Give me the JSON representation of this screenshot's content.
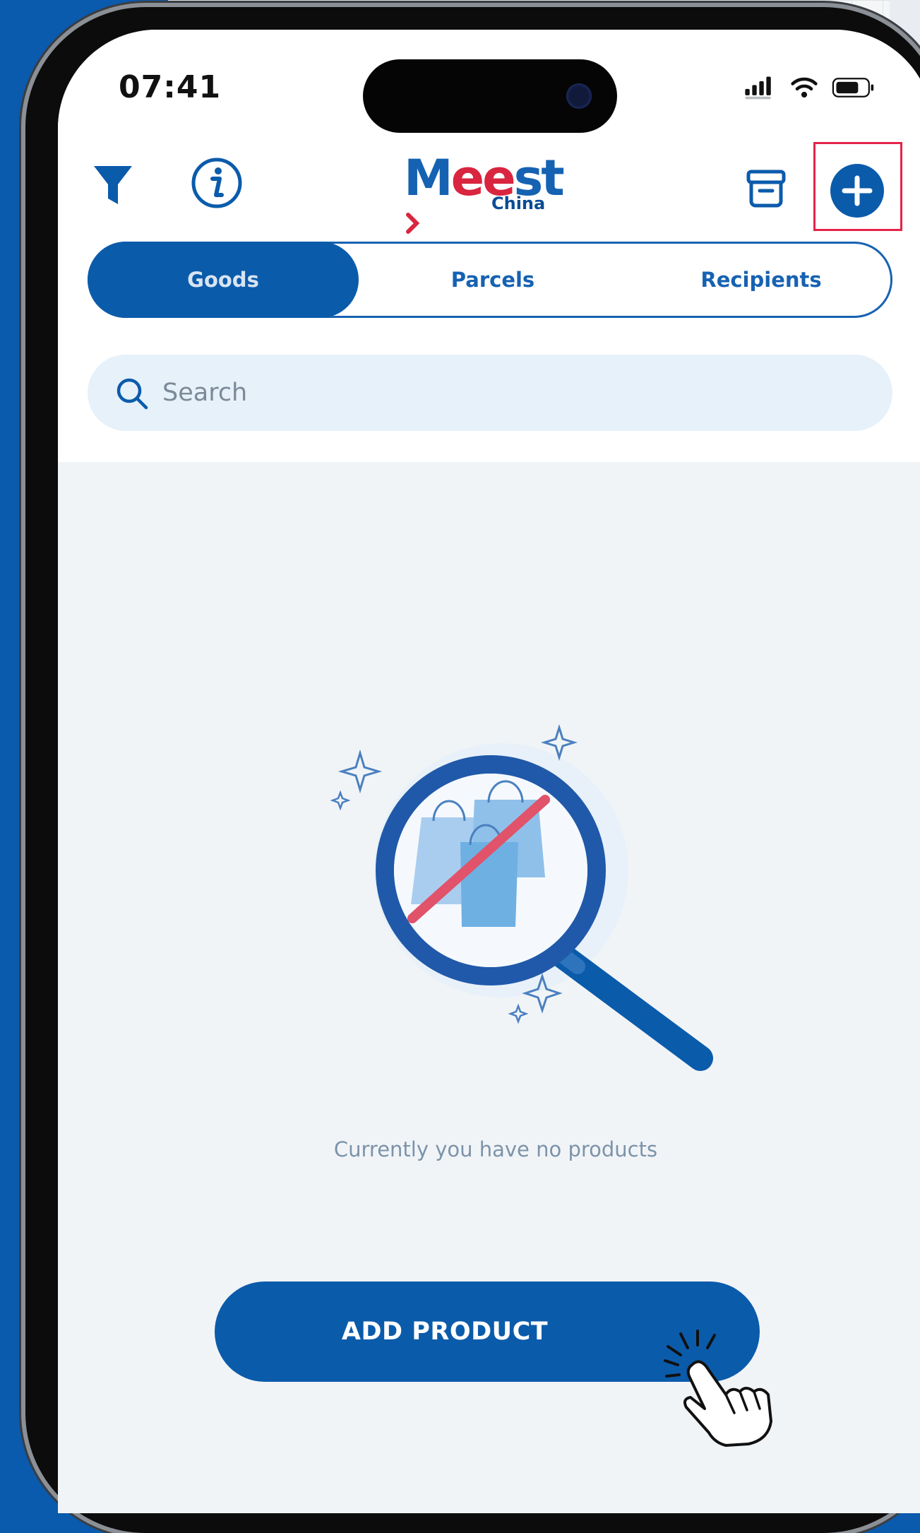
{
  "status_bar": {
    "time": "07:41"
  },
  "header": {
    "logo_text_a": "M",
    "logo_text_b": "ee",
    "logo_text_c": "st",
    "logo_subtitle": "China",
    "icons": [
      "filter-icon",
      "info-icon",
      "archive-icon",
      "add-circle-icon"
    ]
  },
  "tabs": [
    {
      "label": "Goods",
      "active": true
    },
    {
      "label": "Parcels",
      "active": false
    },
    {
      "label": "Recipients",
      "active": false
    }
  ],
  "search": {
    "placeholder": "Search"
  },
  "empty_state": {
    "message": "Currently you have no products"
  },
  "cta": {
    "label": "ADD PRODUCT"
  },
  "colors": {
    "brand_blue": "#0b5bab",
    "brand_red": "#d9253f",
    "highlight": "#e5234b",
    "background": "#f1f4f7"
  }
}
